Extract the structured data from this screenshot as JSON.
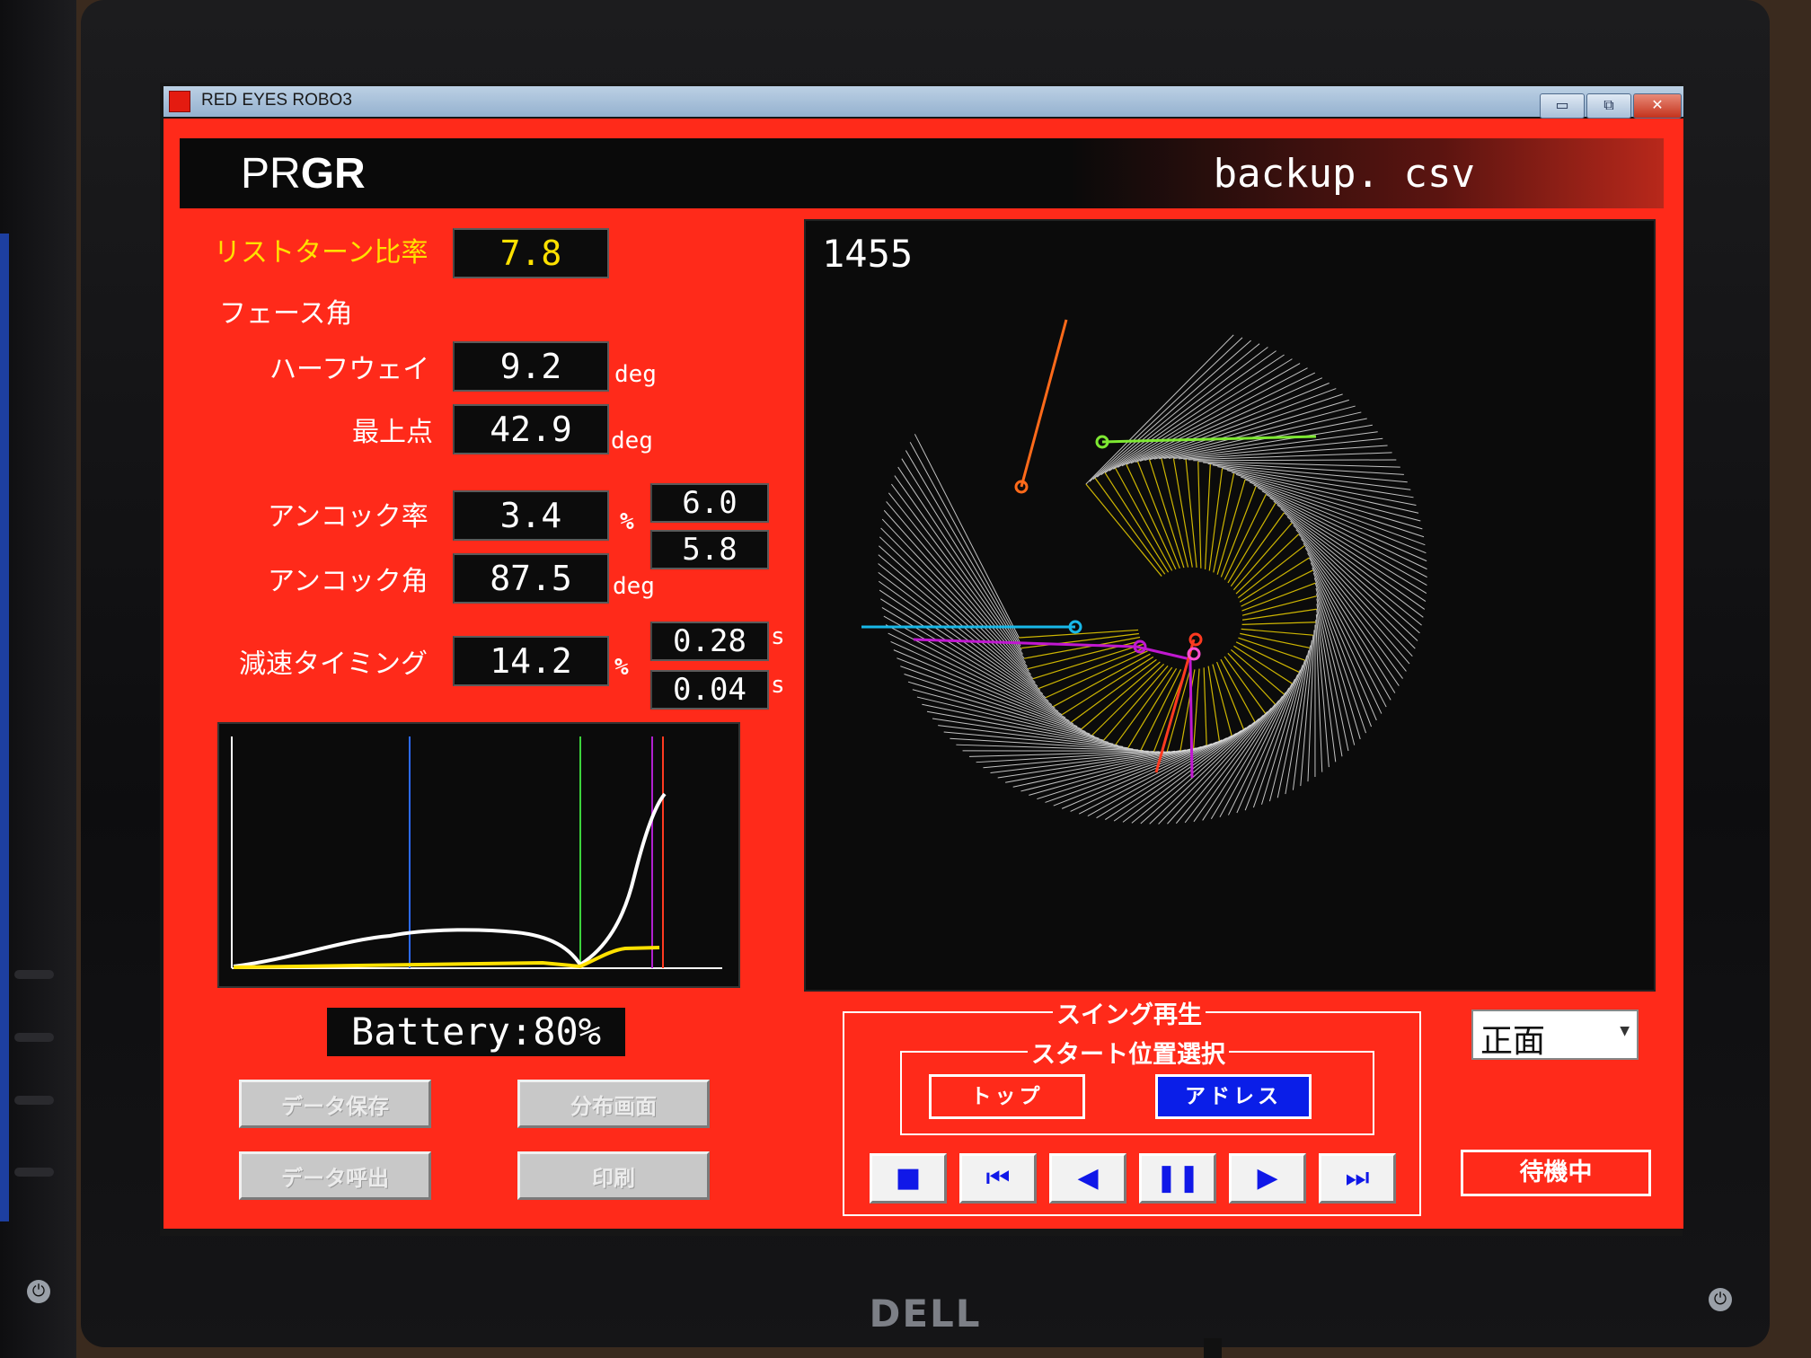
{
  "window": {
    "title": "RED EYES ROBO3",
    "buttons": [
      "▭",
      "⧉",
      "✕"
    ]
  },
  "header": {
    "brand_light": "PR",
    "brand_bold": "GR",
    "filename": "backup. csv"
  },
  "metrics": {
    "wrist_turn": {
      "label": "リストターン比率",
      "value": "7.8"
    },
    "face_angle_label": "フェース角",
    "halfway": {
      "label": "ハーフウェイ",
      "value": "9.2",
      "unit": "deg"
    },
    "top": {
      "label": "最上点",
      "value": "42.9",
      "unit": "deg"
    },
    "uncock_rate": {
      "label": "アンコック率",
      "value": "3.4",
      "unit": "%"
    },
    "uncock_angle": {
      "label": "アンコック角",
      "value": "87.5",
      "unit": "deg"
    },
    "side_a": "6.0",
    "side_b": "5.8",
    "decel": {
      "label": "減速タイミング",
      "value": "14.2",
      "unit": "%"
    },
    "time_a": {
      "value": "0.28",
      "unit": "s"
    },
    "time_b": {
      "value": "0.04",
      "unit": "s"
    }
  },
  "swing_view": {
    "frame": "1455"
  },
  "battery": "Battery:80%",
  "buttons": {
    "save": "データ保存",
    "distribution": "分布画面",
    "load": "データ呼出",
    "print": "印刷"
  },
  "playback": {
    "group_title": "スイング再生",
    "start_group_title": "スタート位置選択",
    "top_button": "トップ",
    "address_button": "アドレス",
    "controls": [
      "stop",
      "first",
      "prev",
      "pause",
      "next",
      "last"
    ]
  },
  "view_select": {
    "value": "正面"
  },
  "status": "待機中",
  "colors": {
    "panel_red": "#ff2a1a",
    "display_black": "#0b0b0b",
    "label_yellow": "#ffe100",
    "active_blue": "#0a1ee8",
    "control_blue": "#1018e8"
  }
}
